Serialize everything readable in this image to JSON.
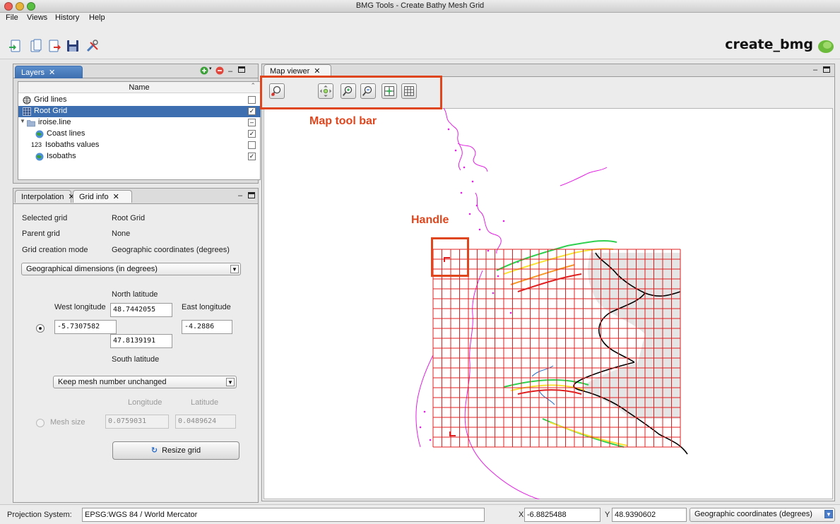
{
  "window": {
    "title": "BMG Tools - Create Bathy Mesh Grid"
  },
  "menubar": {
    "items": [
      "File",
      "Views",
      "History",
      "Help"
    ]
  },
  "toolbar": {
    "app_name": "create_bmg",
    "icons": [
      "import-grid-icon",
      "open-file-icon",
      "export-file-icon",
      "save-icon",
      "tools-icon"
    ]
  },
  "layers": {
    "tab_label": "Layers",
    "column_header": "Name",
    "rows": [
      {
        "label": "Grid lines",
        "icon": "grid-lines-icon",
        "checked": false,
        "selected": false,
        "indent": 0
      },
      {
        "label": "Root Grid",
        "icon": "root-grid-icon",
        "checked": true,
        "selected": true,
        "indent": 0
      },
      {
        "label": "iroise.line",
        "icon": "folder-icon",
        "checked": false,
        "selected": false,
        "indent": 0,
        "tri_state": true
      },
      {
        "label": "Coast lines",
        "icon": "coast-lines-icon",
        "checked": true,
        "selected": false,
        "indent": 1
      },
      {
        "label": "Isobaths values",
        "icon": "numbers-icon",
        "checked": false,
        "selected": false,
        "indent": 1,
        "icon_text": "123"
      },
      {
        "label": "Isobaths",
        "icon": "isobaths-icon",
        "checked": true,
        "selected": false,
        "indent": 1
      }
    ]
  },
  "grid_info": {
    "tabs": [
      "Interpolation",
      "Grid info"
    ],
    "selected_grid_label": "Selected grid",
    "selected_grid_value": "Root Grid",
    "parent_grid_label": "Parent grid",
    "parent_grid_value": "None",
    "creation_mode_label": "Grid creation mode",
    "creation_mode_value": "Geographic coordinates (degrees)",
    "dimensions_select": "Geographical dimensions (in degrees)",
    "north_latitude_label": "North latitude",
    "north_latitude": "48.7442055",
    "west_longitude_label": "West longitude",
    "west_longitude": "-5.7307582",
    "east_longitude_label": "East longitude",
    "east_longitude": "-4.2886",
    "south_latitude": "47.8139191",
    "south_latitude_label": "South latitude",
    "mesh_select": "Keep mesh number unchanged",
    "longitude_label": "Longitude",
    "latitude_label": "Latitude",
    "mesh_size_label": "Mesh size",
    "mesh_longitude": "0.0759031",
    "mesh_latitude": "0.0489624",
    "resize_button": "Resize grid"
  },
  "map_viewer": {
    "tab_label": "Map viewer",
    "annotation_toolbar": "Map tool bar",
    "annotation_handle": "Handle"
  },
  "statusbar": {
    "projection_label": "Projection System:",
    "projection_value": "EPSG:WGS 84 / World Mercator",
    "x_label": "X",
    "x_value": "-6.8825488",
    "y_label": "Y",
    "y_value": "48.9390602",
    "coord_select": "Geographic coordinates (degrees)"
  },
  "colors": {
    "accent_blue": "#3d6fb0",
    "annotation": "#e0461d",
    "coast": "#000000",
    "grid": "#e02020",
    "isobath_magenta": "#e020e0"
  }
}
